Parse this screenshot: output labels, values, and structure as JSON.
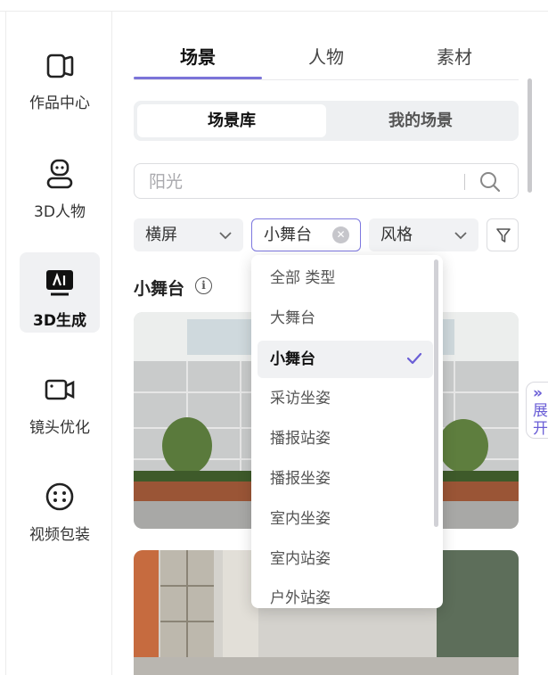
{
  "sidebar": {
    "items": [
      {
        "label": "作品中心",
        "icon": "works-icon"
      },
      {
        "label": "3D人物",
        "icon": "person-icon"
      },
      {
        "label": "3D生成",
        "icon": "ai-generate-icon",
        "active": true
      },
      {
        "label": "镜头优化",
        "icon": "camera-icon"
      },
      {
        "label": "视频包装",
        "icon": "package-icon"
      }
    ]
  },
  "tabs": [
    {
      "label": "场景",
      "active": true
    },
    {
      "label": "人物"
    },
    {
      "label": "素材"
    }
  ],
  "segment": {
    "library": "场景库",
    "mine": "我的场景"
  },
  "search": {
    "placeholder": "阳光"
  },
  "filters": {
    "orientation": "横屏",
    "type": "小舞台",
    "style": "风格"
  },
  "section": {
    "title": "小舞台"
  },
  "dropdown": {
    "options": [
      "全部 类型",
      "大舞台",
      "小舞台",
      "采访坐姿",
      "播报站姿",
      "播报坐姿",
      "室内坐姿",
      "室内站姿",
      "户外站姿"
    ],
    "selected": "小舞台"
  },
  "expand": {
    "arrows": "»",
    "label": "展开"
  },
  "colors": {
    "accent": "#7b74d8",
    "expand_text": "#6a5ed6"
  }
}
